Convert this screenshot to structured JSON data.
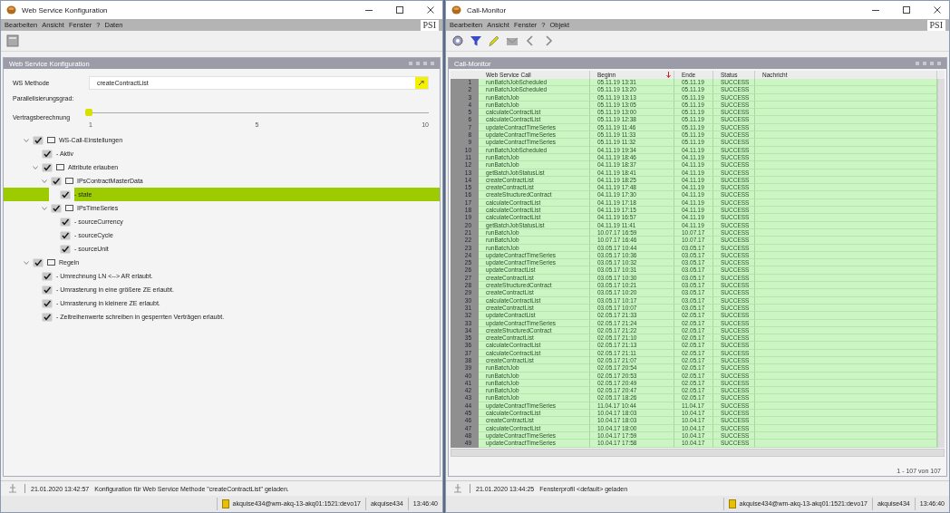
{
  "config_window": {
    "title": "Web Service Konfiguration",
    "menu": [
      "Bearbeiten",
      "Ansicht",
      "Fenster",
      "?",
      "Daten"
    ],
    "logo": "PSI",
    "panel_title": "Web Service Konfiguration",
    "method": {
      "label": "WS Methode",
      "value": "createContractList"
    },
    "parallel_label": "Parallelisierungsgrad:",
    "slider": {
      "label": "Vertragsberechnung",
      "level": 0,
      "ticks": [
        "1",
        "5",
        "10"
      ]
    },
    "tree": [
      {
        "kind": "folder",
        "label": "WS-Call-Einstellungen",
        "checked": true,
        "selected": false,
        "expanded": true,
        "children": [
          {
            "kind": "leaf",
            "label": "- Aktiv",
            "checked": true,
            "selected": false
          },
          {
            "kind": "folder",
            "label": "Attribute erlauben",
            "checked": true,
            "selected": false,
            "expanded": true,
            "children": [
              {
                "kind": "folder",
                "label": "IPsContractMasterData",
                "checked": true,
                "selected": false,
                "expanded": true,
                "children": [
                  {
                    "kind": "leaf",
                    "label": "- state",
                    "checked": true,
                    "selected": true
                  }
                ]
              },
              {
                "kind": "folder",
                "label": "IPsTimeSeries",
                "checked": true,
                "selected": false,
                "expanded": true,
                "children": [
                  {
                    "kind": "leaf",
                    "label": "- sourceCurrency",
                    "checked": true,
                    "selected": false
                  },
                  {
                    "kind": "leaf",
                    "label": "- sourceCycle",
                    "checked": true,
                    "selected": false
                  },
                  {
                    "kind": "leaf",
                    "label": "- sourceUnit",
                    "checked": true,
                    "selected": false
                  }
                ]
              }
            ]
          }
        ]
      },
      {
        "kind": "folder",
        "label": "Regeln",
        "checked": true,
        "selected": false,
        "expanded": true,
        "children": [
          {
            "kind": "leaf",
            "label": "- Umrechnung LN <--> AR erlaubt.",
            "checked": true,
            "selected": false
          },
          {
            "kind": "leaf",
            "label": "- Umrasterung in eine größere ZE erlaubt.",
            "checked": true,
            "selected": false
          },
          {
            "kind": "leaf",
            "label": "- Umrasterung in kleinere ZE erlaubt.",
            "checked": true,
            "selected": false
          },
          {
            "kind": "leaf",
            "label": "- Zeitreihenwerte schreiben in gesperrten Verträgen erlaubt.",
            "checked": true,
            "selected": false
          }
        ]
      }
    ],
    "message": {
      "time": "21.01.2020 13:42:57",
      "text": "Konfiguration für Web Service Methode \"createContractList\" geladen."
    },
    "status": {
      "connection": "akquise434@wm-akq-13-akq01:1521:devo17",
      "user": "akquise434",
      "clock": "13:46:40"
    }
  },
  "monitor_window": {
    "title": "Call-Monitor",
    "menu": [
      "Bearbeiten",
      "Ansicht",
      "Fenster",
      "?",
      "Objekt"
    ],
    "logo": "PSI",
    "panel_title": "Call-Monitor",
    "columns": [
      {
        "label": "Web Service Call",
        "sorted": false
      },
      {
        "label": "Beginn",
        "sorted": true
      },
      {
        "label": "Ende",
        "sorted": false
      },
      {
        "label": "Status",
        "sorted": false
      },
      {
        "label": "Nachricht",
        "sorted": false
      }
    ],
    "rows": [
      {
        "n": "1",
        "call": "runBatchJobScheduled",
        "begin": "05.11.19 13:31",
        "end": "05.11.19",
        "status": "SUCCESS"
      },
      {
        "n": "2",
        "call": "runBatchJobScheduled",
        "begin": "05.11.19 13:20",
        "end": "05.11.19",
        "status": "SUCCESS"
      },
      {
        "n": "3",
        "call": "runBatchJob",
        "begin": "05.11.19 13:13",
        "end": "05.11.19",
        "status": "SUCCESS"
      },
      {
        "n": "4",
        "call": "runBatchJob",
        "begin": "05.11.19 13:05",
        "end": "05.11.19",
        "status": "SUCCESS"
      },
      {
        "n": "5",
        "call": "calculateContractList",
        "begin": "05.11.19 13:00",
        "end": "05.11.19",
        "status": "SUCCESS"
      },
      {
        "n": "6",
        "call": "calculateContractList",
        "begin": "05.11.19 12:38",
        "end": "05.11.19",
        "status": "SUCCESS"
      },
      {
        "n": "7",
        "call": "updateContractTimeSeries",
        "begin": "05.11.19 11:46",
        "end": "05.11.19",
        "status": "SUCCESS"
      },
      {
        "n": "8",
        "call": "updateContractTimeSeries",
        "begin": "05.11.19 11:33",
        "end": "05.11.19",
        "status": "SUCCESS"
      },
      {
        "n": "9",
        "call": "updateContractTimeSeries",
        "begin": "05.11.19 11:32",
        "end": "05.11.19",
        "status": "SUCCESS"
      },
      {
        "n": "10",
        "call": "runBatchJobScheduled",
        "begin": "04.11.19 19:34",
        "end": "04.11.19",
        "status": "SUCCESS"
      },
      {
        "n": "11",
        "call": "runBatchJob",
        "begin": "04.11.19 18:46",
        "end": "04.11.19",
        "status": "SUCCESS"
      },
      {
        "n": "12",
        "call": "runBatchJob",
        "begin": "04.11.19 18:37",
        "end": "04.11.19",
        "status": "SUCCESS"
      },
      {
        "n": "13",
        "call": "getBatchJobStatusList",
        "begin": "04.11.19 18:41",
        "end": "04.11.19",
        "status": "SUCCESS"
      },
      {
        "n": "14",
        "call": "createContractList",
        "begin": "04.11.19 18:25",
        "end": "04.11.19",
        "status": "SUCCESS"
      },
      {
        "n": "15",
        "call": "createContractList",
        "begin": "04.11.19 17:48",
        "end": "04.11.19",
        "status": "SUCCESS"
      },
      {
        "n": "16",
        "call": "createStructuredContract",
        "begin": "04.11.19 17:30",
        "end": "04.11.19",
        "status": "SUCCESS"
      },
      {
        "n": "17",
        "call": "calculateContractList",
        "begin": "04.11.19 17:18",
        "end": "04.11.19",
        "status": "SUCCESS"
      },
      {
        "n": "18",
        "call": "calculateContractList",
        "begin": "04.11.19 17:15",
        "end": "04.11.19",
        "status": "SUCCESS"
      },
      {
        "n": "19",
        "call": "calculateContractList",
        "begin": "04.11.19 16:57",
        "end": "04.11.19",
        "status": "SUCCESS"
      },
      {
        "n": "20",
        "call": "getBatchJobStatusList",
        "begin": "04.11.19 11:41",
        "end": "04.11.19",
        "status": "SUCCESS"
      },
      {
        "n": "21",
        "call": "runBatchJob",
        "begin": "10.07.17 16:59",
        "end": "10.07.17",
        "status": "SUCCESS"
      },
      {
        "n": "22",
        "call": "runBatchJob",
        "begin": "10.07.17 16:46",
        "end": "10.07.17",
        "status": "SUCCESS"
      },
      {
        "n": "23",
        "call": "runBatchJob",
        "begin": "03.05.17 10:44",
        "end": "03.05.17",
        "status": "SUCCESS"
      },
      {
        "n": "24",
        "call": "updateContractTimeSeries",
        "begin": "03.05.17 10:36",
        "end": "03.05.17",
        "status": "SUCCESS"
      },
      {
        "n": "25",
        "call": "updateContractTimeSeries",
        "begin": "03.05.17 10:32",
        "end": "03.05.17",
        "status": "SUCCESS"
      },
      {
        "n": "26",
        "call": "updateContractList",
        "begin": "03.05.17 10:31",
        "end": "03.05.17",
        "status": "SUCCESS"
      },
      {
        "n": "27",
        "call": "createContractList",
        "begin": "03.05.17 10:30",
        "end": "03.05.17",
        "status": "SUCCESS"
      },
      {
        "n": "28",
        "call": "createStructuredContract",
        "begin": "03.05.17 10:21",
        "end": "03.05.17",
        "status": "SUCCESS"
      },
      {
        "n": "29",
        "call": "createContractList",
        "begin": "03.05.17 10:20",
        "end": "03.05.17",
        "status": "SUCCESS"
      },
      {
        "n": "30",
        "call": "calculateContractList",
        "begin": "03.05.17 10:17",
        "end": "03.05.17",
        "status": "SUCCESS"
      },
      {
        "n": "31",
        "call": "createContractList",
        "begin": "03.05.17 10:07",
        "end": "03.05.17",
        "status": "SUCCESS"
      },
      {
        "n": "32",
        "call": "updateContractList",
        "begin": "02.05.17 21:33",
        "end": "02.05.17",
        "status": "SUCCESS"
      },
      {
        "n": "33",
        "call": "updateContractTimeSeries",
        "begin": "02.05.17 21:24",
        "end": "02.05.17",
        "status": "SUCCESS"
      },
      {
        "n": "34",
        "call": "createStructuredContract",
        "begin": "02.05.17 21:22",
        "end": "02.05.17",
        "status": "SUCCESS"
      },
      {
        "n": "35",
        "call": "createContractList",
        "begin": "02.05.17 21:10",
        "end": "02.05.17",
        "status": "SUCCESS"
      },
      {
        "n": "36",
        "call": "calculateContractList",
        "begin": "02.05.17 21:13",
        "end": "02.05.17",
        "status": "SUCCESS"
      },
      {
        "n": "37",
        "call": "calculateContractList",
        "begin": "02.05.17 21:11",
        "end": "02.05.17",
        "status": "SUCCESS"
      },
      {
        "n": "38",
        "call": "createContractList",
        "begin": "02.05.17 21:07",
        "end": "02.05.17",
        "status": "SUCCESS"
      },
      {
        "n": "39",
        "call": "runBatchJob",
        "begin": "02.05.17 20:54",
        "end": "02.05.17",
        "status": "SUCCESS"
      },
      {
        "n": "40",
        "call": "runBatchJob",
        "begin": "02.05.17 20:53",
        "end": "02.05.17",
        "status": "SUCCESS"
      },
      {
        "n": "41",
        "call": "runBatchJob",
        "begin": "02.05.17 20:49",
        "end": "02.05.17",
        "status": "SUCCESS"
      },
      {
        "n": "42",
        "call": "runBatchJob",
        "begin": "02.05.17 20:47",
        "end": "02.05.17",
        "status": "SUCCESS"
      },
      {
        "n": "43",
        "call": "runBatchJob",
        "begin": "02.05.17 18:26",
        "end": "02.05.17",
        "status": "SUCCESS"
      },
      {
        "n": "44",
        "call": "updateContractTimeSeries",
        "begin": "11.04.17 10:44",
        "end": "11.04.17",
        "status": "SUCCESS"
      },
      {
        "n": "45",
        "call": "calculateContractList",
        "begin": "10.04.17 18:03",
        "end": "10.04.17",
        "status": "SUCCESS"
      },
      {
        "n": "46",
        "call": "createContractList",
        "begin": "10.04.17 18:03",
        "end": "10.04.17",
        "status": "SUCCESS"
      },
      {
        "n": "47",
        "call": "calculateContractList",
        "begin": "10.04.17 18:00",
        "end": "10.04.17",
        "status": "SUCCESS"
      },
      {
        "n": "48",
        "call": "updateContractTimeSeries",
        "begin": "10.04.17 17:59",
        "end": "10.04.17",
        "status": "SUCCESS"
      },
      {
        "n": "49",
        "call": "updateContractTimeSeries",
        "begin": "10.04.17 17:58",
        "end": "10.04.17",
        "status": "SUCCESS"
      }
    ],
    "count": "1 - 107 von 107",
    "message": {
      "time": "21.01.2020 13:44:25",
      "text": "Fensterprofil <default> geladen"
    },
    "status": {
      "connection": "akquise434@wm-akq-13-akq01:1521:devo17",
      "user": "akquise434",
      "clock": "13:46:40"
    }
  }
}
